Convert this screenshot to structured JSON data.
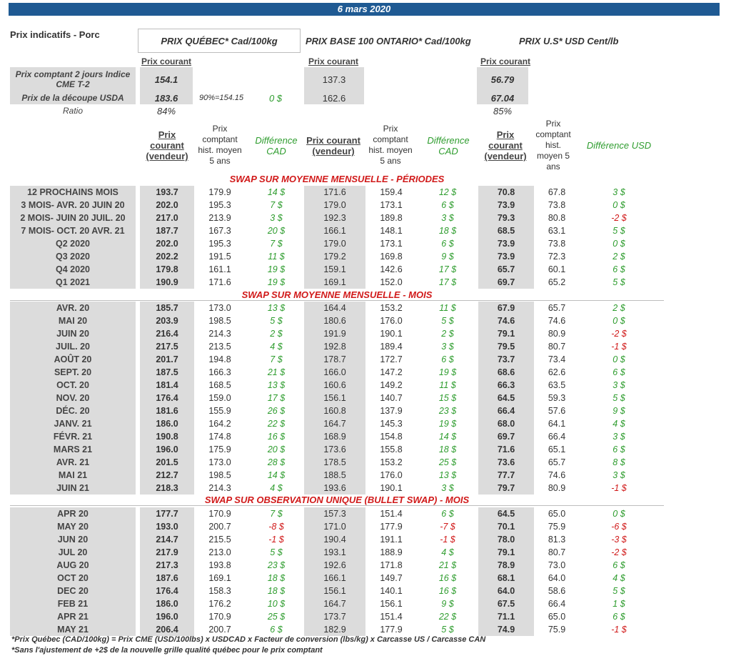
{
  "date": "6 mars 2020",
  "header": {
    "label": "Prix indicatifs - Porc",
    "quebec_title": "PRIX QUÉBEC* Cad/100kg",
    "ontario_title": "PRIX BASE 100 ONTARIO* Cad/100kg",
    "us_title": "PRIX U.S* USD Cent/lb",
    "prix_courant": "Prix courant"
  },
  "top": {
    "row1_label": "Prix comptant 2 jours Indice CME T-2",
    "row2_label": "Prix de la découpe USDA",
    "ratio_label": "Ratio",
    "q_cash": "154.1",
    "o_cash": "137.3",
    "u_cash": "56.79",
    "q_cut": "183.6",
    "q_pct": "90%=154.15",
    "q_diff": "0 $",
    "o_cut": "162.6",
    "u_cut": "67.04",
    "q_ratio": "84%",
    "u_ratio": "85%"
  },
  "colheads": {
    "prix_courant_vendeur_1": "Prix",
    "prix_courant_vendeur_2": "courant",
    "prix_courant_vendeur_3": "(vendeur)",
    "hist_1": "Prix",
    "hist_2": "comptant",
    "hist_3": "hist. moyen",
    "hist_4": "5 ans",
    "diff_cad_1": "Différence",
    "diff_cad_2": "CAD",
    "o_cur_1": "Prix courant",
    "o_cur_2": "(vendeur)",
    "u_hist_1": "Prix",
    "u_hist_2": "comptant",
    "u_hist_3": "hist.",
    "u_hist_4": "moyen 5",
    "u_hist_5": "ans",
    "diff_usd": "Différence USD"
  },
  "sections": [
    {
      "title": "SWAP SUR MOYENNE MENSUELLE - PÉRIODES",
      "rows": [
        [
          "12 PROCHAINS MOIS",
          "193.7",
          "179.9",
          "14 $",
          "171.6",
          "159.4",
          "12 $",
          "70.8",
          "67.8",
          "3 $"
        ],
        [
          "3 MOIS- AVR. 20 JUIN 20",
          "202.0",
          "195.3",
          "7 $",
          "179.0",
          "173.1",
          "6 $",
          "73.9",
          "73.8",
          "0 $"
        ],
        [
          "2 MOIS- JUIN 20 JUIL. 20",
          "217.0",
          "213.9",
          "3 $",
          "192.3",
          "189.8",
          "3 $",
          "79.3",
          "80.8",
          "-2 $"
        ],
        [
          "7 MOIS- OCT. 20 AVR. 21",
          "187.7",
          "167.3",
          "20 $",
          "166.1",
          "148.1",
          "18 $",
          "68.5",
          "63.1",
          "5 $"
        ],
        [
          "Q2 2020",
          "202.0",
          "195.3",
          "7 $",
          "179.0",
          "173.1",
          "6 $",
          "73.9",
          "73.8",
          "0 $"
        ],
        [
          "Q3 2020",
          "202.2",
          "191.5",
          "11 $",
          "179.2",
          "169.8",
          "9 $",
          "73.9",
          "72.3",
          "2 $"
        ],
        [
          "Q4 2020",
          "179.8",
          "161.1",
          "19 $",
          "159.1",
          "142.6",
          "17 $",
          "65.7",
          "60.1",
          "6 $"
        ],
        [
          "Q1 2021",
          "190.9",
          "171.6",
          "19 $",
          "169.1",
          "152.0",
          "17 $",
          "69.7",
          "65.2",
          "5 $"
        ]
      ]
    },
    {
      "title": "SWAP SUR MOYENNE MENSUELLE - MOIS",
      "rows": [
        [
          "AVR. 20",
          "185.7",
          "173.0",
          "13 $",
          "164.4",
          "153.2",
          "11 $",
          "67.9",
          "65.7",
          "2 $"
        ],
        [
          "MAI 20",
          "203.9",
          "198.5",
          "5 $",
          "180.6",
          "176.0",
          "5 $",
          "74.6",
          "74.6",
          "0 $"
        ],
        [
          "JUIN 20",
          "216.4",
          "214.3",
          "2 $",
          "191.9",
          "190.1",
          "2 $",
          "79.1",
          "80.9",
          "-2 $"
        ],
        [
          "JUIL. 20",
          "217.5",
          "213.5",
          "4 $",
          "192.8",
          "189.4",
          "3 $",
          "79.5",
          "80.7",
          "-1 $"
        ],
        [
          "AOÛT 20",
          "201.7",
          "194.8",
          "7 $",
          "178.7",
          "172.7",
          "6 $",
          "73.7",
          "73.4",
          "0 $"
        ],
        [
          "SEPT. 20",
          "187.5",
          "166.3",
          "21 $",
          "166.0",
          "147.2",
          "19 $",
          "68.6",
          "62.6",
          "6 $"
        ],
        [
          "OCT. 20",
          "181.4",
          "168.5",
          "13 $",
          "160.6",
          "149.2",
          "11 $",
          "66.3",
          "63.5",
          "3 $"
        ],
        [
          "NOV. 20",
          "176.4",
          "159.0",
          "17 $",
          "156.1",
          "140.7",
          "15 $",
          "64.5",
          "59.3",
          "5 $"
        ],
        [
          "DÉC. 20",
          "181.6",
          "155.9",
          "26 $",
          "160.8",
          "137.9",
          "23 $",
          "66.4",
          "57.6",
          "9 $"
        ],
        [
          "JANV. 21",
          "186.0",
          "164.2",
          "22 $",
          "164.7",
          "145.3",
          "19 $",
          "68.0",
          "64.1",
          "4 $"
        ],
        [
          "FÉVR. 21",
          "190.8",
          "174.8",
          "16 $",
          "168.9",
          "154.8",
          "14 $",
          "69.7",
          "66.4",
          "3 $"
        ],
        [
          "MARS 21",
          "196.0",
          "175.9",
          "20 $",
          "173.6",
          "155.8",
          "18 $",
          "71.6",
          "65.1",
          "6 $"
        ],
        [
          "AVR. 21",
          "201.5",
          "173.0",
          "28 $",
          "178.5",
          "153.2",
          "25 $",
          "73.6",
          "65.7",
          "8 $"
        ],
        [
          "MAI 21",
          "212.7",
          "198.5",
          "14 $",
          "188.5",
          "176.0",
          "13 $",
          "77.7",
          "74.6",
          "3 $"
        ],
        [
          "JUIN 21",
          "218.3",
          "214.3",
          "4 $",
          "193.6",
          "190.1",
          "3 $",
          "79.7",
          "80.9",
          "-1 $"
        ]
      ]
    },
    {
      "title": "SWAP SUR OBSERVATION UNIQUE (BULLET SWAP) - MOIS",
      "rows": [
        [
          "APR 20",
          "177.7",
          "170.9",
          "7 $",
          "157.3",
          "151.4",
          "6 $",
          "64.5",
          "65.0",
          "0 $"
        ],
        [
          "MAY 20",
          "193.0",
          "200.7",
          "-8 $",
          "171.0",
          "177.9",
          "-7 $",
          "70.1",
          "75.9",
          "-6 $"
        ],
        [
          "JUN 20",
          "214.7",
          "215.5",
          "-1 $",
          "190.4",
          "191.1",
          "-1 $",
          "78.0",
          "81.3",
          "-3 $"
        ],
        [
          "JUL 20",
          "217.9",
          "213.0",
          "5 $",
          "193.1",
          "188.9",
          "4 $",
          "79.1",
          "80.7",
          "-2 $"
        ],
        [
          "AUG 20",
          "217.3",
          "193.8",
          "23 $",
          "192.6",
          "171.8",
          "21 $",
          "78.9",
          "73.0",
          "6 $"
        ],
        [
          "OCT 20",
          "187.6",
          "169.1",
          "18 $",
          "166.1",
          "149.7",
          "16 $",
          "68.1",
          "64.0",
          "4 $"
        ],
        [
          "DEC 20",
          "176.4",
          "158.3",
          "18 $",
          "156.1",
          "140.1",
          "16 $",
          "64.0",
          "58.6",
          "5 $"
        ],
        [
          "FEB 21",
          "186.0",
          "176.2",
          "10 $",
          "164.7",
          "156.1",
          "9 $",
          "67.5",
          "66.4",
          "1 $"
        ],
        [
          "APR 21",
          "196.0",
          "170.9",
          "25 $",
          "173.7",
          "151.4",
          "22 $",
          "71.1",
          "65.0",
          "6 $"
        ],
        [
          "MAY 21",
          "206.4",
          "200.7",
          "6 $",
          "182.9",
          "177.9",
          "5 $",
          "74.9",
          "75.9",
          "-1 $"
        ]
      ]
    }
  ],
  "footnotes": [
    "*Prix Québec (CAD/100kg) = Prix CME (USD/100lbs) x USDCAD x Facteur de conversion (lbs/kg) x Carcasse US / Carcasse CAN",
    "*Sans l'ajustement de +2$ de la nouvelle grille qualité québec pour le prix comptant"
  ]
}
